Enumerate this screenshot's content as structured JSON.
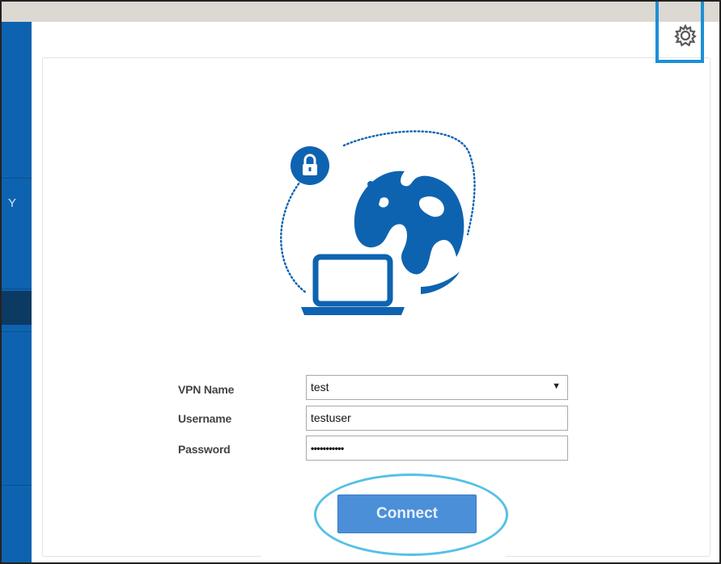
{
  "sidebar": {
    "partial_label": "Y"
  },
  "toolbar": {
    "settings_icon": "gear-icon"
  },
  "illustration": {
    "icons": [
      "lock-icon",
      "globe-icon",
      "laptop-icon"
    ]
  },
  "form": {
    "vpn_name_label": "VPN Name",
    "vpn_name_value": "test",
    "username_label": "Username",
    "username_value": "testuser",
    "password_label": "Password",
    "password_value": "•••••••••••",
    "connect_label": "Connect"
  },
  "colors": {
    "brand_blue": "#0e63b0",
    "button_blue": "#4a8fd8",
    "highlight": "#1c8fd6",
    "ellipse": "#55c0e6"
  }
}
